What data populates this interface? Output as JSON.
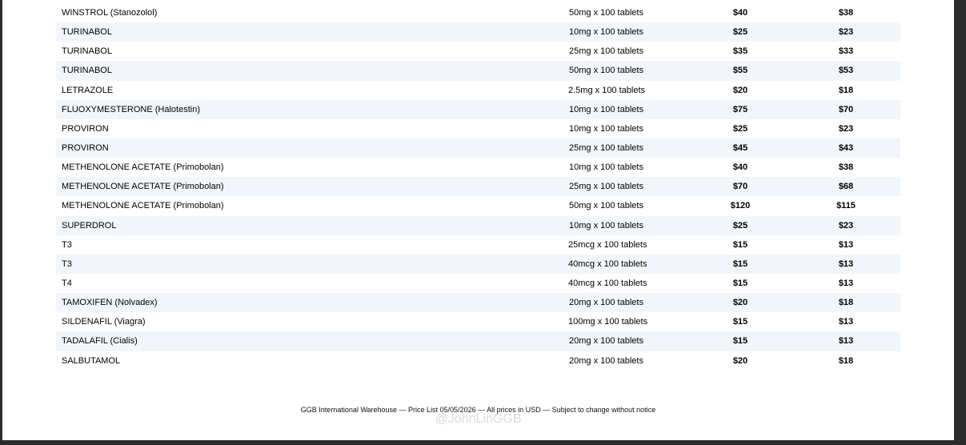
{
  "rows": [
    {
      "name": "WINSTROL (Stanozolol)",
      "dose": "50mg x 100 tablets",
      "price1": "$40",
      "price2": "$38"
    },
    {
      "name": "TURINABOL",
      "dose": "10mg x 100 tablets",
      "price1": "$25",
      "price2": "$23"
    },
    {
      "name": "TURINABOL",
      "dose": "25mg x 100 tablets",
      "price1": "$35",
      "price2": "$33"
    },
    {
      "name": "TURINABOL",
      "dose": "50mg x 100 tablets",
      "price1": "$55",
      "price2": "$53"
    },
    {
      "name": "LETRAZOLE",
      "dose": "2.5mg x 100 tablets",
      "price1": "$20",
      "price2": "$18"
    },
    {
      "name": "FLUOXYMESTERONE (Halotestin)",
      "dose": "10mg x 100 tablets",
      "price1": "$75",
      "price2": "$70"
    },
    {
      "name": "PROVIRON",
      "dose": "10mg x 100 tablets",
      "price1": "$25",
      "price2": "$23"
    },
    {
      "name": "PROVIRON",
      "dose": "25mg x 100 tablets",
      "price1": "$45",
      "price2": "$43"
    },
    {
      "name": "METHENOLONE ACETATE (Primobolan)",
      "dose": "10mg x 100 tablets",
      "price1": "$40",
      "price2": "$38"
    },
    {
      "name": "METHENOLONE ACETATE (Primobolan)",
      "dose": "25mg x 100 tablets",
      "price1": "$70",
      "price2": "$68"
    },
    {
      "name": "METHENOLONE ACETATE (Primobolan)",
      "dose": "50mg x 100 tablets",
      "price1": "$120",
      "price2": "$115"
    },
    {
      "name": "SUPERDROL",
      "dose": "10mg x 100 tablets",
      "price1": "$25",
      "price2": "$23"
    },
    {
      "name": "T3",
      "dose": "25mcg x 100 tablets",
      "price1": "$15",
      "price2": "$13"
    },
    {
      "name": "T3",
      "dose": "40mcg x 100 tablets",
      "price1": "$15",
      "price2": "$13"
    },
    {
      "name": "T4",
      "dose": "40mcg x 100 tablets",
      "price1": "$15",
      "price2": "$13"
    },
    {
      "name": "TAMOXIFEN (Nolvadex)",
      "dose": "20mg x 100 tablets",
      "price1": "$20",
      "price2": "$18"
    },
    {
      "name": "SILDENAFIL (Viagra)",
      "dose": "100mg x 100 tablets",
      "price1": "$15",
      "price2": "$13"
    },
    {
      "name": "TADALAFIL (Cialis)",
      "dose": "20mg x 100 tablets",
      "price1": "$15",
      "price2": "$13"
    },
    {
      "name": "SALBUTAMOL",
      "dose": "20mg x 100 tablets",
      "price1": "$20",
      "price2": "$18"
    }
  ],
  "footer": "GGB International Warehouse — Price List 05/05/2026 — All prices in USD — Subject to change without notice",
  "watermark": "@JohnLinGGB",
  "colors": {
    "row_alt": "#f2f6fa",
    "viewer_background": "#2b2b2b"
  }
}
